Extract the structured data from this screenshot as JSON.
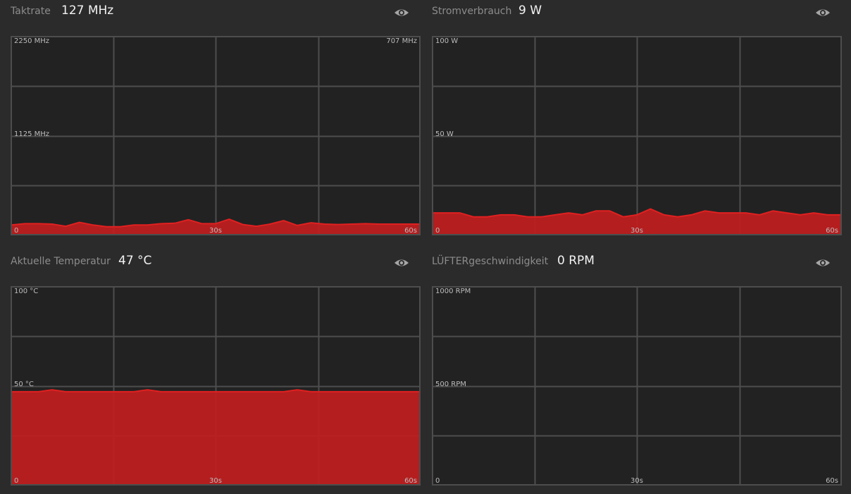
{
  "colors": {
    "background": "#2b2b2b",
    "chart_bg": "#222222",
    "grid": "#4d4d4d",
    "fill": "#c01e1f",
    "line": "#e02020"
  },
  "panels": [
    {
      "label": "Taktrate",
      "value": "127 MHz",
      "icon": "eye-icon",
      "ymax_label": "2250 MHz",
      "ymid_label": "1125 MHz",
      "peak_label": "707 MHz",
      "x_start": "0",
      "x_mid": "30s",
      "x_end": "60s"
    },
    {
      "label": "Stromverbrauch",
      "value": "9 W",
      "icon": "eye-icon",
      "ymax_label": "100 W",
      "ymid_label": "50 W",
      "x_start": "0",
      "x_mid": "30s",
      "x_end": "60s"
    },
    {
      "label": "Aktuelle Temperatur",
      "value": "47 °C",
      "icon": "eye-icon",
      "ymax_label": "100 °C",
      "ymid_label": "50 °C",
      "x_start": "0",
      "x_mid": "30s",
      "x_end": "60s"
    },
    {
      "label": "LÜFTERgeschwindigkeit",
      "value": "0 RPM",
      "icon": "eye-icon",
      "ymax_label": "1000 RPM",
      "ymid_label": "500 RPM",
      "x_start": "0",
      "x_mid": "30s",
      "x_end": "60s"
    }
  ],
  "chart_data": [
    {
      "type": "area",
      "title": "Taktrate",
      "xlim": [
        0,
        60
      ],
      "ylim": [
        0,
        2250
      ],
      "grid": true,
      "x": [
        0,
        2,
        4,
        6,
        8,
        10,
        12,
        14,
        16,
        18,
        20,
        22,
        24,
        26,
        28,
        30,
        32,
        34,
        36,
        38,
        40,
        42,
        44,
        46,
        48,
        50,
        52,
        54,
        56,
        58,
        60
      ],
      "series": [
        {
          "values": [
            110,
            125,
            125,
            120,
            95,
            140,
            110,
            90,
            90,
            110,
            110,
            125,
            130,
            170,
            125,
            125,
            175,
            115,
            95,
            120,
            160,
            105,
            135,
            120,
            115,
            120,
            125,
            120,
            120,
            120,
            120
          ]
        }
      ]
    },
    {
      "type": "area",
      "title": "Stromverbrauch",
      "xlim": [
        0,
        60
      ],
      "ylim": [
        0,
        100
      ],
      "grid": true,
      "x": [
        0,
        2,
        4,
        6,
        8,
        10,
        12,
        14,
        16,
        18,
        20,
        22,
        24,
        26,
        28,
        30,
        32,
        34,
        36,
        38,
        40,
        42,
        44,
        46,
        48,
        50,
        52,
        54,
        56,
        58,
        60
      ],
      "series": [
        {
          "values": [
            11,
            11,
            11,
            9,
            9,
            10,
            10,
            9,
            9,
            10,
            11,
            10,
            12,
            12,
            9,
            10,
            13,
            10,
            9,
            10,
            12,
            11,
            11,
            11,
            10,
            12,
            11,
            10,
            11,
            10,
            10
          ]
        }
      ]
    },
    {
      "type": "area",
      "title": "Aktuelle Temperatur",
      "xlim": [
        0,
        60
      ],
      "ylim": [
        0,
        100
      ],
      "grid": true,
      "x": [
        0,
        2,
        4,
        6,
        8,
        10,
        12,
        14,
        16,
        18,
        20,
        22,
        24,
        26,
        28,
        30,
        32,
        34,
        36,
        38,
        40,
        42,
        44,
        46,
        48,
        50,
        52,
        54,
        56,
        58,
        60
      ],
      "series": [
        {
          "values": [
            47,
            47,
            47,
            48,
            47,
            47,
            47,
            47,
            47,
            47,
            48,
            47,
            47,
            47,
            47,
            47,
            47,
            47,
            47,
            47,
            47,
            48,
            47,
            47,
            47,
            47,
            47,
            47,
            47,
            47,
            47
          ]
        }
      ]
    },
    {
      "type": "area",
      "title": "LÜFTERgeschwindigkeit",
      "xlim": [
        0,
        60
      ],
      "ylim": [
        0,
        1000
      ],
      "grid": true,
      "x": [
        0,
        60
      ],
      "series": [
        {
          "values": [
            0,
            0
          ]
        }
      ]
    }
  ]
}
